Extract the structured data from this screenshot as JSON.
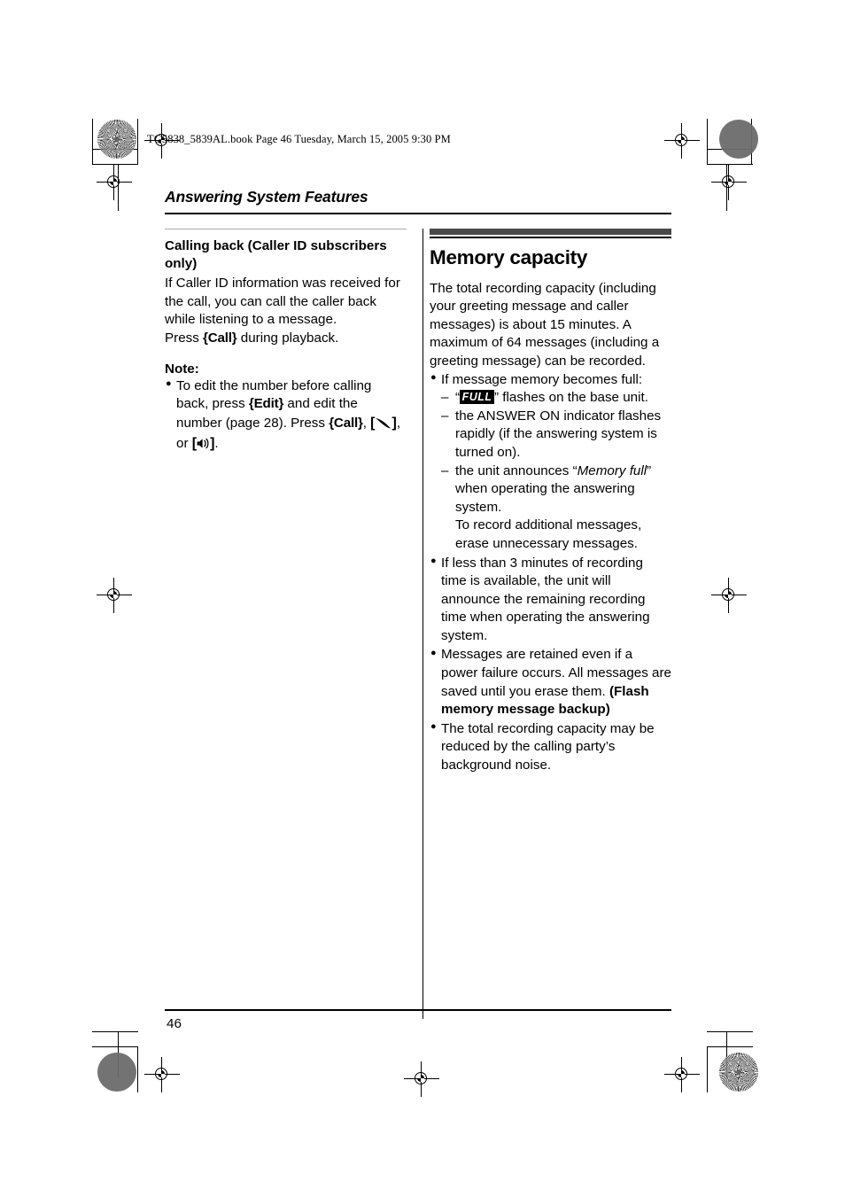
{
  "document": {
    "file_header": "TG5838_5839AL.book  Page 46  Tuesday, March 15, 2005  9:30 PM",
    "chapter_title": "Answering System Features",
    "page_number": "46",
    "accent_bar_color": "#4a4a4a",
    "rule_color": "#000000"
  },
  "left_column": {
    "section_heading": "Calling back (Caller ID subscribers only)",
    "paragraph_1": "If Caller ID information was received for the call, you can call the caller back while listening to a message.",
    "paragraph_2_pre": "Press ",
    "paragraph_2_key": "{Call}",
    "paragraph_2_post": " during playback.",
    "note_label": "Note:",
    "note_bullet": {
      "text_1": "To edit the number before calling back, press ",
      "key_1": "{Edit}",
      "text_2": " and edit the number (page 28). Press ",
      "key_2": "{Call}",
      "text_3": ", ",
      "icon_1": "talk-handset-icon",
      "text_4": ", or ",
      "icon_2": "speakerphone-icon",
      "text_5": "."
    }
  },
  "right_column": {
    "section_heading": "Memory capacity",
    "intro_paragraph": "The total recording capacity (including your greeting message and caller messages) is about 15 minutes. A maximum of 64 messages (including a greeting message) can be recorded.",
    "bullets": [
      {
        "lead": "If message memory becomes full:",
        "sub_items": [
          {
            "pre": "“",
            "lcd": "FULL",
            "post": "” flashes on the base unit."
          },
          {
            "pre": "",
            "lcd": "",
            "post": "the ANSWER ON indicator flashes rapidly (if the answering system is turned on)."
          },
          {
            "pre": "the unit announces “",
            "em": "Memory full",
            "post": "” when operating the answering system."
          }
        ],
        "trailer": "To record additional messages, erase unnecessary messages."
      },
      {
        "lead": "If less than 3 minutes of recording time is available, the unit will announce the remaining recording time when operating the answering system."
      },
      {
        "lead": "Messages are retained even if a power failure occurs. All messages are saved until you erase them. ",
        "bold_tail": "(Flash memory message backup)"
      },
      {
        "lead": "The total recording capacity may be reduced by the calling party’s background noise."
      }
    ]
  }
}
